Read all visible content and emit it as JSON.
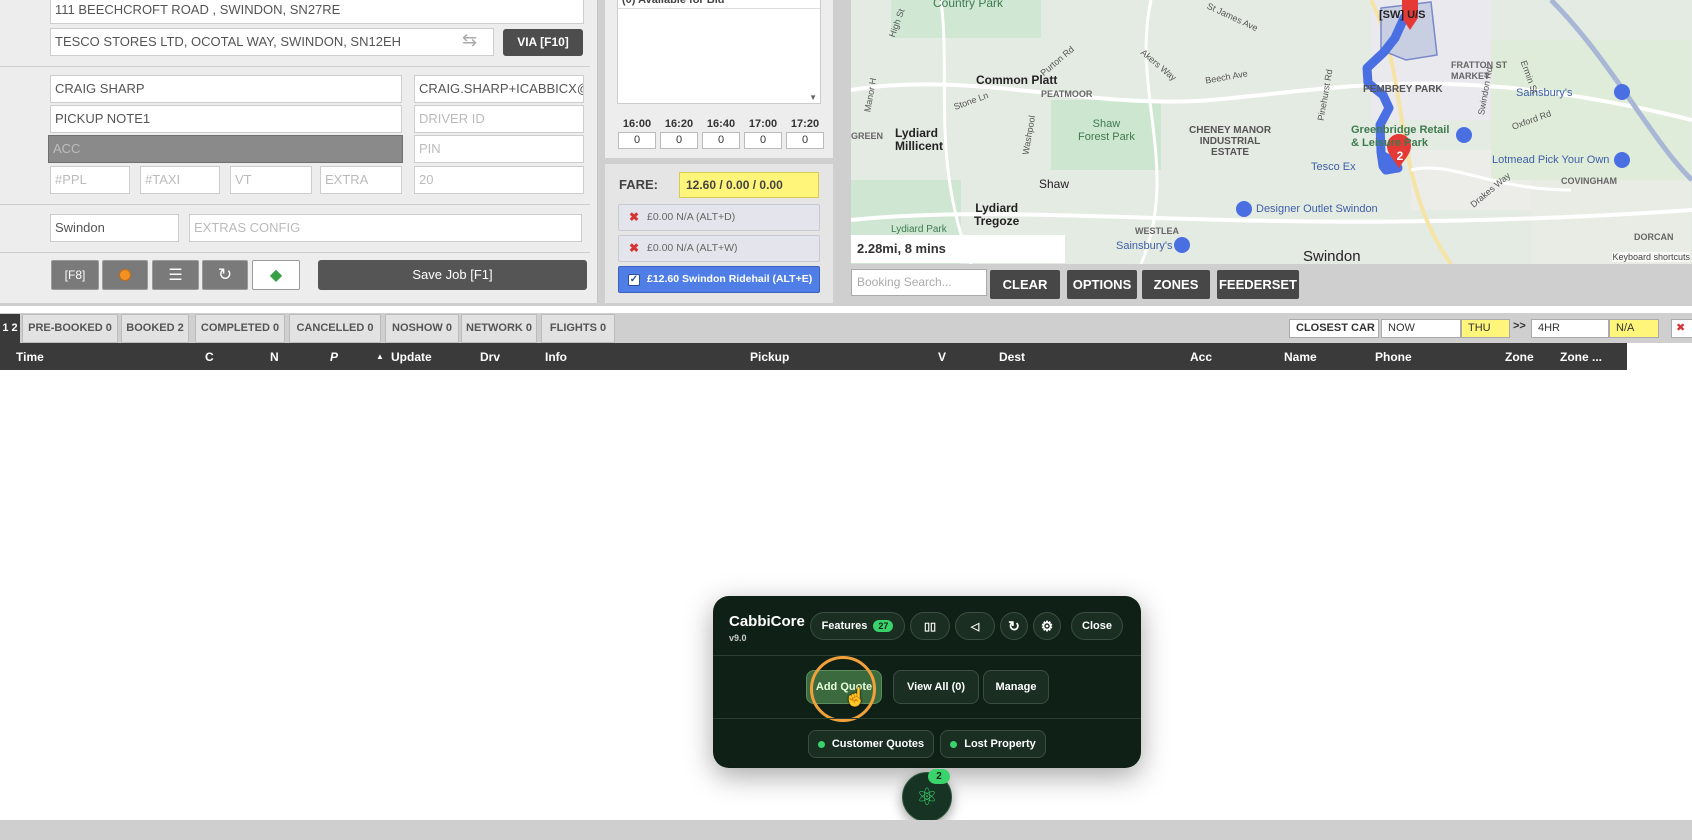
{
  "form": {
    "address_from": "111 BEECHCROFT ROAD , SWINDON, SN27RE",
    "address_to": "TESCO STORES LTD, OCOTAL WAY, SWINDON, SN12EH",
    "via_label": "VIA [F10]",
    "name": "CRAIG SHARP",
    "email": "CRAIG.SHARP+ICABBICX@",
    "pickup_note": "PICKUP NOTE1",
    "driver_id_placeholder": "DRIVER ID",
    "acc_placeholder": "ACC",
    "pin_placeholder": "PIN",
    "ppl_placeholder": "#PPL",
    "taxi_placeholder": "#TAXI",
    "vt_placeholder": "VT",
    "extra_placeholder": "EXTRA",
    "twenty_value": "20",
    "zone": "Swindon",
    "extras_placeholder": "EXTRAS CONFIG",
    "f8_label": "[F8]",
    "save_label": "Save Job [F1]"
  },
  "availability": {
    "header": "(0) Available for Bid",
    "times": [
      "16:00",
      "16:20",
      "16:40",
      "17:00",
      "17:20"
    ],
    "counts": [
      "0",
      "0",
      "0",
      "0",
      "0"
    ]
  },
  "fare": {
    "label": "FARE:",
    "value": "12.60 / 0.00 / 0.00",
    "options": [
      "£0.00 N/A (ALT+D)",
      "£0.00 N/A (ALT+W)",
      "£12.60 Swindon Ridehail (ALT+E)"
    ]
  },
  "map": {
    "distance": "2.28mi, 8 mins",
    "search_placeholder": "Booking Search...",
    "buttons": [
      "CLEAR",
      "OPTIONS",
      "ZONES",
      "FEEDERSET"
    ],
    "keyboard_shortcuts": "Keyboard shortcuts",
    "marker_count": "2",
    "labels": {
      "country_park": "Country Park",
      "sw_us": "[SW] U/S",
      "common_platt": "Common Platt",
      "peatmoor": "PEATMOOR",
      "pembrey_park": "PEMBREY PARK",
      "fratton": "FRATTON ST\nMARKET",
      "green": "GREEN",
      "lydiard_millicent": "Lydiard\nMillicent",
      "shaw_forest_park": "Shaw\nForest Park",
      "cheney_manor": "CHENEY MANOR\nINDUSTRIAL\nESTATE",
      "greenbridge": "Greenbridge Retail\n& Leisure Park",
      "sainsburys_top": "Sainsbury's",
      "lotmead": "Lotmead Pick Your Own",
      "tesco": "Tesco Ex",
      "shaw": "Shaw",
      "covingham": "COVINGHAM",
      "lydiard_tregoze": "Lydiard\nTregoze",
      "designer_outlet": "Designer Outlet Swindon",
      "lydiard_park": "Lydiard Park",
      "westlea": "WESTLEA",
      "sainsburys_bottom": "Sainsbury's",
      "swindon": "Swindon",
      "dorcan": "DORCAN",
      "high_st": "High St",
      "st_james": "St James Ave",
      "purton_rd": "Purton Rd",
      "beech_ave": "Beech Ave",
      "akers_way": "Akers Way",
      "stone_ln": "Stone Ln",
      "oxford_rd": "Oxford Rd",
      "drakes_way": "Drakes Way",
      "ermin_st": "Ermin St",
      "swindon_rd": "Swindon Rd",
      "washpool": "Washpool",
      "pinehurst_rd": "Pinehurst Rd",
      "manor_h": "Manor H"
    }
  },
  "tabs": [
    {
      "label": "1 2"
    },
    {
      "label": "PRE-BOOKED 0"
    },
    {
      "label": "BOOKED 2"
    },
    {
      "label": "COMPLETED 0"
    },
    {
      "label": "CANCELLED 0"
    },
    {
      "label": "NOSHOW 0"
    },
    {
      "label": "NETWORK 0"
    },
    {
      "label": "FLIGHTS 0"
    }
  ],
  "filters": {
    "closest_car": "CLOSEST CAR",
    "now": "NOW",
    "day": "THU",
    "arrow": ">>",
    "range": "4HR",
    "na": "N/A"
  },
  "columns": [
    "Time",
    "C",
    "N",
    "P",
    "Update",
    "Drv",
    "Info",
    "Pickup",
    "V",
    "Dest",
    "Acc",
    "Name",
    "Phone",
    "Zone",
    "Zone ..."
  ],
  "popup": {
    "title": "CabbiCore",
    "version": "v9.0",
    "features_label": "Features",
    "features_count": "27",
    "close_label": "Close",
    "add_quote": "Add Quote",
    "view_all": "View All (0)",
    "manage": "Manage",
    "customer_quotes": "Customer Quotes",
    "lost_property": "Lost Property",
    "fab_badge": "2"
  },
  "colors": {
    "accent_green": "#39d36b",
    "highlight_ring": "#f2a13a",
    "fare_yellow": "#fff57a",
    "selected_fare": "#4f7fe6",
    "route_blue": "#4a6fe3",
    "marker_red": "#e53935"
  }
}
